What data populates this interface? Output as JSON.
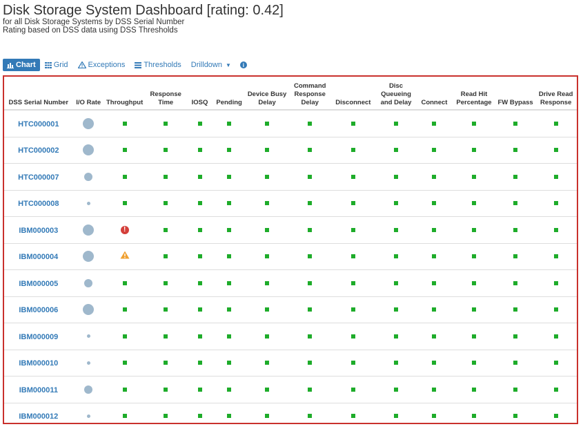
{
  "header": {
    "title": "Disk Storage System Dashboard [rating: 0.42]",
    "subtitle1": "for all Disk Storage Systems by DSS Serial Number",
    "subtitle2": "Rating based on DSS data using DSS Thresholds"
  },
  "toolbar": {
    "chart": "Chart",
    "grid": "Grid",
    "exceptions": "Exceptions",
    "thresholds": "Thresholds",
    "drilldown": "Drilldown",
    "info": "i"
  },
  "colors": {
    "accent": "#337ab7",
    "ok": "#1eac2a",
    "error": "#d43f3a",
    "warning": "#f0a030",
    "border": "#c9302c",
    "io_circle": "#9fb8cc"
  },
  "table": {
    "headers": [
      "DSS Serial Number",
      "I/O Rate",
      "Throughput",
      "Response Time",
      "IOSQ",
      "Pending",
      "Device Busy Delay",
      "Command Response Delay",
      "Disconnect",
      "Disc Queueing and Delay",
      "Connect",
      "Read Hit Percentage",
      "FW Bypass",
      "Drive Read Response"
    ],
    "rows": [
      {
        "serial": "HTC000001",
        "io_rate": "large",
        "throughput": "ok"
      },
      {
        "serial": "HTC000002",
        "io_rate": "large",
        "throughput": "ok"
      },
      {
        "serial": "HTC000007",
        "io_rate": "medium",
        "throughput": "ok"
      },
      {
        "serial": "HTC000008",
        "io_rate": "small",
        "throughput": "ok"
      },
      {
        "serial": "IBM000003",
        "io_rate": "large",
        "throughput": "error"
      },
      {
        "serial": "IBM000004",
        "io_rate": "large",
        "throughput": "warning"
      },
      {
        "serial": "IBM000005",
        "io_rate": "medium",
        "throughput": "ok"
      },
      {
        "serial": "IBM000006",
        "io_rate": "large",
        "throughput": "ok"
      },
      {
        "serial": "IBM000009",
        "io_rate": "small",
        "throughput": "ok"
      },
      {
        "serial": "IBM000010",
        "io_rate": "small",
        "throughput": "ok"
      },
      {
        "serial": "IBM000011",
        "io_rate": "medium",
        "throughput": "ok"
      },
      {
        "serial": "IBM000012",
        "io_rate": "small",
        "throughput": "ok"
      }
    ]
  }
}
